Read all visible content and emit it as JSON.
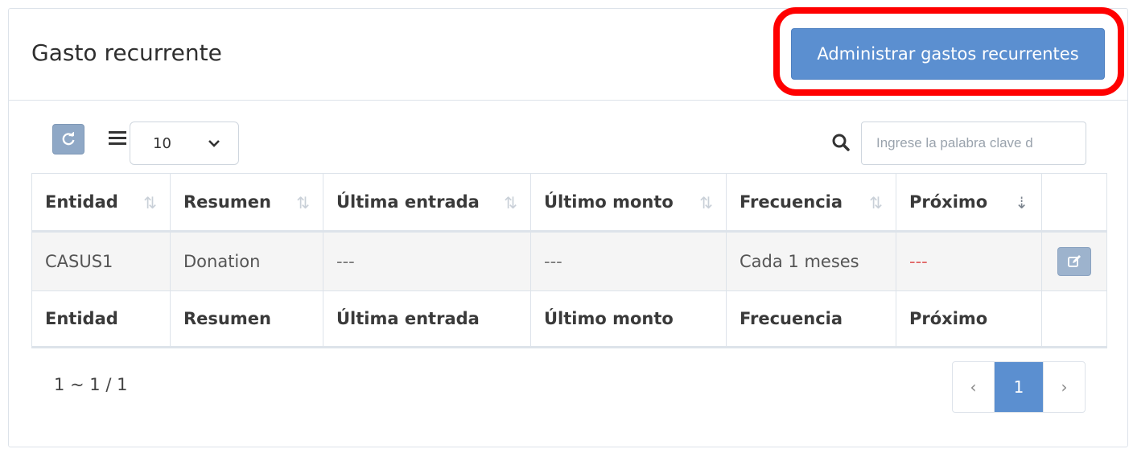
{
  "panel": {
    "title": "Gasto recurrente",
    "manage_button": "Administrar gastos recurrentes"
  },
  "toolbar": {
    "page_size": "10",
    "search_placeholder": "Ingrese la palabra clave d"
  },
  "table": {
    "columns": [
      "Entidad",
      "Resumen",
      "Última entrada",
      "Último monto",
      "Frecuencia",
      "Próximo"
    ],
    "rows": [
      {
        "entidad": "CASUS1",
        "resumen": "Donation",
        "ultima_entrada": "---",
        "ultimo_monto": "---",
        "frecuencia": "Cada 1 meses",
        "proximo": "---"
      }
    ],
    "footer": [
      "Entidad",
      "Resumen",
      "Última entrada",
      "Último monto",
      "Frecuencia",
      "Próximo"
    ]
  },
  "pagination": {
    "info": "1 ~ 1 / 1",
    "prev": "‹",
    "current": "1",
    "next": "›"
  },
  "colors": {
    "primary": "#5b8fd0",
    "highlight": "#ff0000"
  }
}
